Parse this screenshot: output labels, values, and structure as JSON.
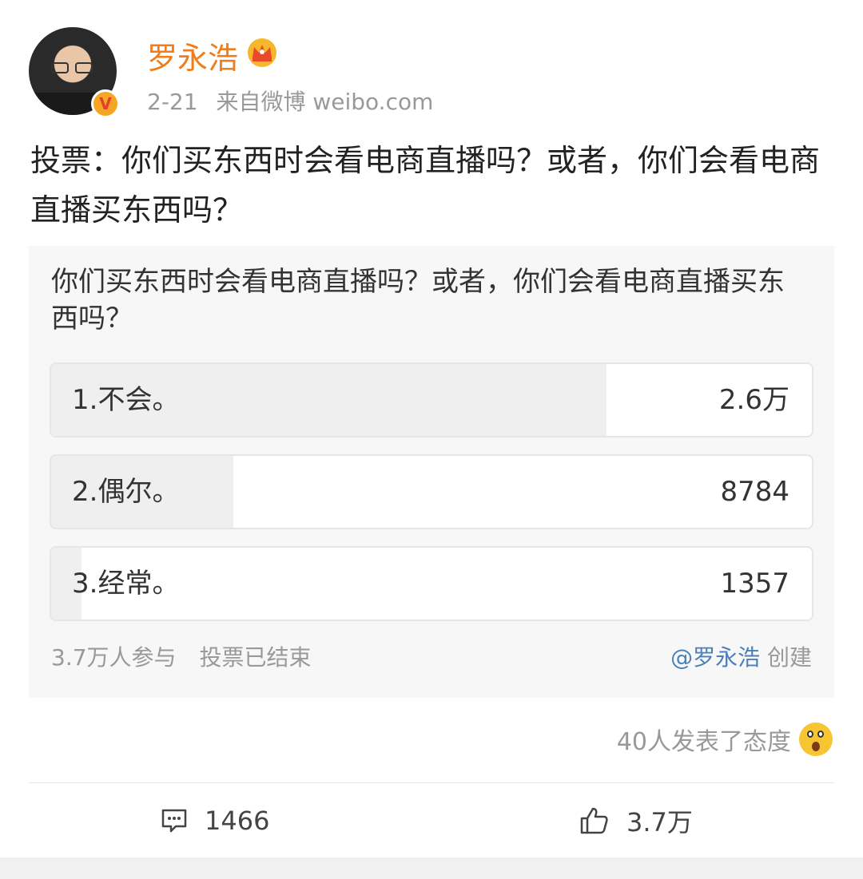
{
  "user": {
    "name": "罗永浩",
    "date": "2-21",
    "source": "来自微博 weibo.com",
    "verified_icon": "verified-v-icon",
    "badge_icon": "crown-icon"
  },
  "post": {
    "text": "投票：你们买东西时会看电商直播吗？或者，你们会看电商直播买东西吗？"
  },
  "poll": {
    "question": "你们买东西时会看电商直播吗？或者，你们会看电商直播买东西吗？",
    "options": [
      {
        "label": "1.不会。",
        "count": "2.6万",
        "share": 0.73
      },
      {
        "label": "2.偶尔。",
        "count": "8784",
        "share": 0.24
      },
      {
        "label": "3.经常。",
        "count": "1357",
        "share": 0.04
      }
    ],
    "participants": "3.7万人参与",
    "status": "投票已结束",
    "creator": "@罗永浩",
    "created_label": "创建"
  },
  "reactions": {
    "text": "40人发表了态度",
    "emoji_icon": "surprised-emoji-icon"
  },
  "actions": {
    "comments": "1466",
    "likes": "3.7万"
  },
  "colors": {
    "username": "#f07c1b",
    "creator_link": "#4a7fb8",
    "poll_bg": "#f7f7f7",
    "option_fill": "#efefef"
  }
}
